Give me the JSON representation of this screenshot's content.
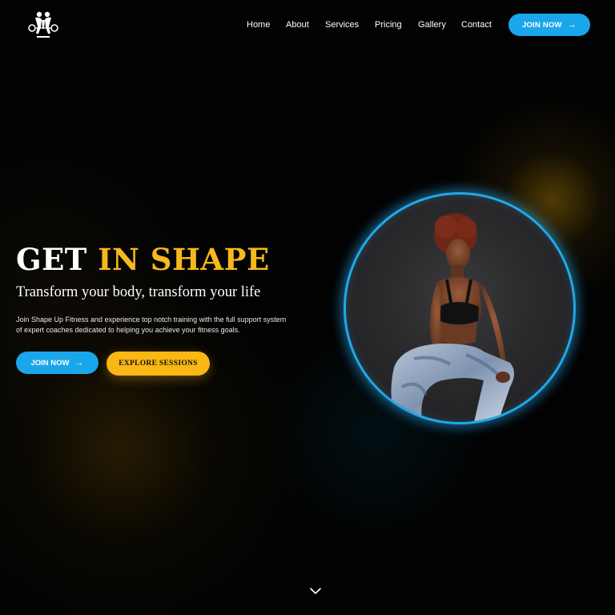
{
  "header": {
    "logo_icon": "fitness-logo-icon",
    "nav": [
      {
        "label": "Home"
      },
      {
        "label": "About"
      },
      {
        "label": "Services"
      },
      {
        "label": "Pricing"
      },
      {
        "label": "Gallery"
      },
      {
        "label": "Contact"
      }
    ],
    "cta_label": "JOIN NOW",
    "cta_icon": "arrow-right-icon"
  },
  "hero": {
    "title_white": "GET",
    "title_accent": "IN SHAPE",
    "subtitle": "Transform your body, transform your life",
    "description": "Join Shape Up Fitness and experience top notch training with the full support system of expert coaches dedicated to helping you achieve your fitness goals.",
    "primary_button": "JOIN NOW",
    "secondary_button": "EXPLORE SESSIONS",
    "image_icon": "athlete-photo"
  },
  "footer": {
    "scroll_icon": "chevron-down-icon"
  },
  "colors": {
    "accent_blue": "#1aa6ea",
    "accent_yellow": "#f6b81c",
    "background": "#000000"
  }
}
